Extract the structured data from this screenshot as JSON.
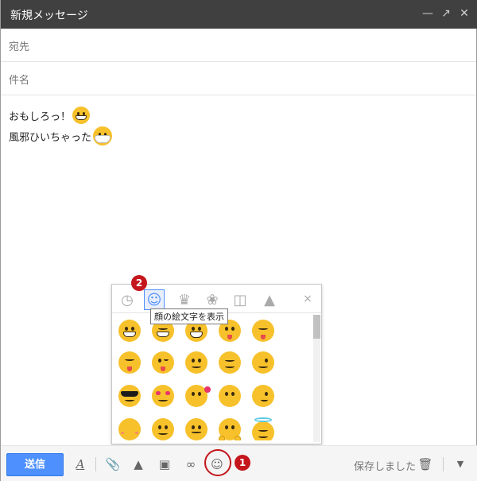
{
  "window": {
    "title": "新規メッセージ",
    "minimize_icon": "minimize-icon",
    "popout_icon": "popout-icon",
    "close_icon": "close-icon"
  },
  "fields": {
    "to_label": "宛先",
    "subject_label": "件名"
  },
  "body": {
    "line1_text": "おもしろっ！",
    "line1_emoji": "grinning-face-icon",
    "line2_text": "風邪ひいちゃった",
    "line2_emoji": "mask-face-icon"
  },
  "picker": {
    "tabs": [
      "recent-icon",
      "face-icon",
      "crown-icon",
      "flower-icon",
      "car-icon",
      "triangle-icon"
    ],
    "active_tab": "face-icon",
    "close_label": "×",
    "tooltip": "顔の絵文字を表示",
    "emojis": [
      [
        "grin",
        "grin-closed",
        "grin-wide",
        "smile-tongue",
        "laugh"
      ],
      [
        "yum",
        "wink-tongue",
        "smile",
        "content",
        "wink"
      ],
      [
        "cool",
        "heart-eyes",
        "kiss-heart",
        "kiss",
        "smirk"
      ],
      [
        "kiss-blush",
        "smile-plain",
        "slight-smile",
        "hug",
        "angel"
      ]
    ]
  },
  "annotations": {
    "badge1": "1",
    "badge2": "2"
  },
  "toolbar": {
    "send_label": "送信",
    "format_label": "A",
    "saved_status": "保存しました"
  },
  "colors": {
    "titlebar": "#404040",
    "send": "#4d90fe",
    "annotation": "#c4161c",
    "emoji": "#f7c12b"
  }
}
